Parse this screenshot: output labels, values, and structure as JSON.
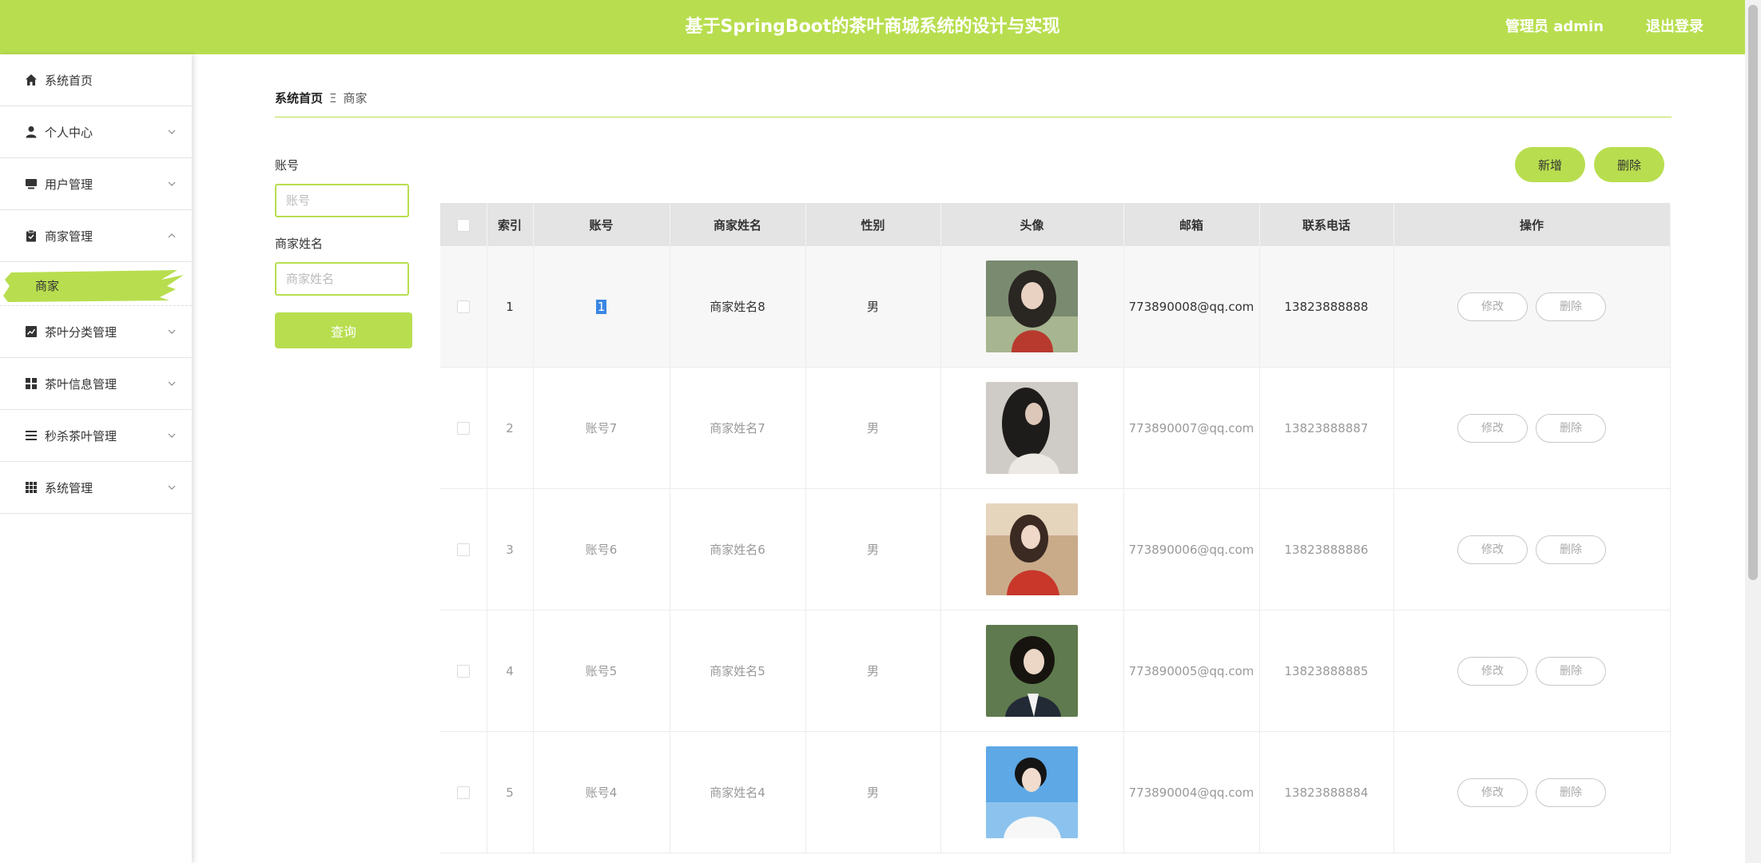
{
  "header": {
    "title": "基于SpringBoot的茶叶商城系统的设计与实现",
    "admin": "管理员 admin",
    "logout": "退出登录"
  },
  "sidebar": {
    "items": [
      {
        "label": "系统首页",
        "icon": "home-icon"
      },
      {
        "label": "个人中心",
        "icon": "user-icon"
      },
      {
        "label": "用户管理",
        "icon": "monitor-icon"
      },
      {
        "label": "商家管理",
        "icon": "clipboard-icon",
        "sub": "商家"
      },
      {
        "label": "茶叶分类管理",
        "icon": "chart-icon"
      },
      {
        "label": "茶叶信息管理",
        "icon": "grid-icon"
      },
      {
        "label": "秒杀茶叶管理",
        "icon": "list-icon"
      },
      {
        "label": "系统管理",
        "icon": "apps-icon"
      }
    ]
  },
  "breadcrumb": {
    "home": "系统首页",
    "separator": "Ξ",
    "current": "商家"
  },
  "filters": {
    "account_label": "账号",
    "account_placeholder": "账号",
    "name_label": "商家姓名",
    "name_placeholder": "商家姓名",
    "search_button": "查询"
  },
  "actions": {
    "add": "新增",
    "delete": "删除"
  },
  "table": {
    "columns": [
      "索引",
      "账号",
      "商家姓名",
      "性别",
      "头像",
      "邮箱",
      "联系电话",
      "操作"
    ],
    "edit_label": "修改",
    "delete_label": "删除",
    "rows": [
      {
        "index": "1",
        "account": "1",
        "name": "商家姓名8",
        "gender": "男",
        "email": "773890008@qq.com",
        "phone": "13823888888"
      },
      {
        "index": "2",
        "account": "账号7",
        "name": "商家姓名7",
        "gender": "男",
        "email": "773890007@qq.com",
        "phone": "13823888887"
      },
      {
        "index": "3",
        "account": "账号6",
        "name": "商家姓名6",
        "gender": "男",
        "email": "773890006@qq.com",
        "phone": "13823888886"
      },
      {
        "index": "4",
        "account": "账号5",
        "name": "商家姓名5",
        "gender": "男",
        "email": "773890005@qq.com",
        "phone": "13823888885"
      },
      {
        "index": "5",
        "account": "账号4",
        "name": "商家姓名4",
        "gender": "男",
        "email": "773890004@qq.com",
        "phone": "13823888884"
      }
    ]
  },
  "colors": {
    "accent": "#b8de4f",
    "header_text": "#ffffff",
    "selection": "#3b85e4"
  }
}
